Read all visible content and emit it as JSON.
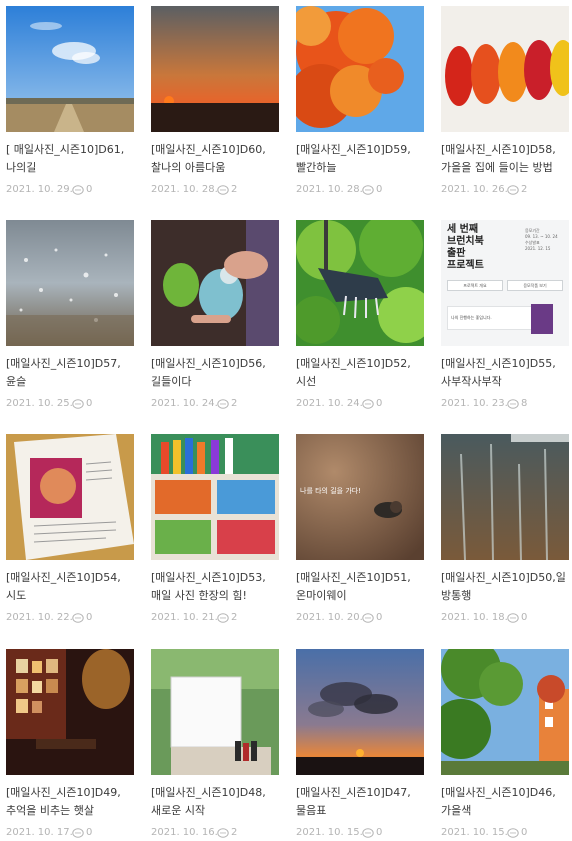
{
  "colors": {
    "title": "#3a3a3a",
    "meta": "#b4b4b4"
  },
  "posts": [
    {
      "title": "[ 매일사진_시즌10]D61, 나의길",
      "date": "2021. 10. 29.",
      "comments": "0",
      "image": "field-path-sky"
    },
    {
      "title": "[매일사진_시즌10]D60, 찰나의 아름다움",
      "date": "2021. 10. 28.",
      "comments": "2",
      "image": "sunset-horizon"
    },
    {
      "title": "[매일사진_시즌10]D59, 빨간하늘",
      "date": "2021. 10. 28.",
      "comments": "0",
      "image": "red-maple-sky"
    },
    {
      "title": "[매일사진_시즌10]D58, 가을을 집에 들이는 방법",
      "date": "2021. 10. 26.",
      "comments": "2",
      "image": "autumn-leaves-row"
    },
    {
      "title": "[매일사진_시즌10]D57, 윤슬",
      "date": "2021. 10. 25.",
      "comments": "0",
      "image": "sparkling-water"
    },
    {
      "title": "[매일사진_시즌10]D56, 길들이다",
      "date": "2021. 10. 24.",
      "comments": "2",
      "image": "budgie-hand"
    },
    {
      "title": "[매일사진_시즌10]D52, 시선",
      "date": "2021. 10. 24.",
      "comments": "0",
      "image": "green-tree-lamp"
    },
    {
      "title": "[매일사진_시즌10]D55, 사부작사부작",
      "date": "2021. 10. 23.",
      "comments": "8",
      "image": "project-poster"
    },
    {
      "title": "[매일사진_시즌10]D54, 시도",
      "date": "2021. 10. 22.",
      "comments": "0",
      "image": "printed-document"
    },
    {
      "title": "[매일사진_시즌10]D53, 매일 사진 한장의 힘!",
      "date": "2021. 10. 21.",
      "comments": "2",
      "image": "photo-prints"
    },
    {
      "title": "[매일사진_시즌10]D51, 온마이웨이",
      "date": "2021. 10. 20.",
      "comments": "0",
      "image": "snail-ground"
    },
    {
      "title": "[매일사진_시즌10]D50,일방통행",
      "date": "2021. 10. 18.",
      "comments": "0",
      "image": "reflection-water"
    },
    {
      "title": "[매일사진_시즌10]D49, 추억을 비추는 햇살",
      "date": "2021. 10. 17.",
      "comments": "0",
      "image": "cafe-wall-frames"
    },
    {
      "title": "[매일사진_시즌10]D48, 새로운 시작",
      "date": "2021. 10. 16.",
      "comments": "2",
      "image": "blank-canvas"
    },
    {
      "title": "[매일사진_시즌10]D47, 물음표",
      "date": "2021. 10. 15.",
      "comments": "0",
      "image": "sunset-clouds"
    },
    {
      "title": "[매일사진_시즌10]D46, 가을색",
      "date": "2021. 10. 15.",
      "comments": "0",
      "image": "autumn-trees-building"
    }
  ],
  "poster": {
    "line1": "세 번째",
    "line2": "브런치북",
    "line3": "출판",
    "line4": "프로젝트",
    "side1": "응모기간",
    "side2": "09. 13. ~ 10. 24",
    "side3": "수상발표",
    "side4": "2021. 12. 15",
    "btn1": "프로젝트 개요",
    "btn2": "응모작품 보기",
    "note": "나의 진행하는 좋입니다."
  },
  "photo_texts": {
    "snail": "나를 타의 길을 가다!"
  }
}
